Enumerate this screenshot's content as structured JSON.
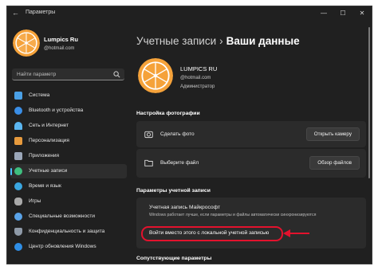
{
  "window": {
    "title": "Параметры",
    "back_glyph": "←",
    "controls": [
      "—",
      "☐",
      "✕"
    ]
  },
  "user": {
    "name": "Lumpics Ru",
    "email": "@hotmail.com",
    "name_upper": "LUMPICS RU",
    "role": "Администратор"
  },
  "search": {
    "placeholder": "Найти параметр"
  },
  "sidebar": {
    "items": [
      {
        "label": "Система",
        "icon": "monitor-icon",
        "color": "#4aa0e6"
      },
      {
        "label": "Bluetooth и устройства",
        "icon": "bluetooth-icon",
        "color": "#3a8ee6"
      },
      {
        "label": "Сеть и Интернет",
        "icon": "wifi-icon",
        "color": "#5bb6f0"
      },
      {
        "label": "Персонализация",
        "icon": "brush-icon",
        "color": "#e79a3d"
      },
      {
        "label": "Приложения",
        "icon": "apps-icon",
        "color": "#9aa6b8"
      },
      {
        "label": "Учетные записи",
        "icon": "user-icon",
        "color": "#3fbf7f",
        "active": true
      },
      {
        "label": "Время и язык",
        "icon": "globe-icon",
        "color": "#3aa6e0"
      },
      {
        "label": "Игры",
        "icon": "gamepad-icon",
        "color": "#a9a9a9"
      },
      {
        "label": "Специальные возможности",
        "icon": "accessibility-icon",
        "color": "#5aa3e8"
      },
      {
        "label": "Конфиденциальность и защита",
        "icon": "shield-icon",
        "color": "#8f9aa8"
      },
      {
        "label": "Центр обновления Windows",
        "icon": "update-icon",
        "color": "#2f8ee6"
      }
    ]
  },
  "breadcrumb": {
    "parent": "Учетные записи",
    "separator": "›",
    "current": "Ваши данные"
  },
  "photo_section": {
    "title": "Настройка фотографии",
    "rows": [
      {
        "label": "Сделать фото",
        "button": "Открыть камеру",
        "icon": "camera-icon"
      },
      {
        "label": "Выберите файл",
        "button": "Обзор файлов",
        "icon": "folder-icon"
      }
    ]
  },
  "account_section": {
    "title": "Параметры учетной записи",
    "account_title": "Учетная запись Майкрософт",
    "account_desc": "Windows работает лучше, если параметры и файлы автоматически синхронизируются",
    "signin_link": "Войти вместо этого с локальной учетной записью"
  },
  "related_section": {
    "title": "Сопутствующие параметры"
  },
  "colors": {
    "accent": "#4cc2ff",
    "highlight": "#e3122d",
    "orange": "#f5a23a"
  }
}
